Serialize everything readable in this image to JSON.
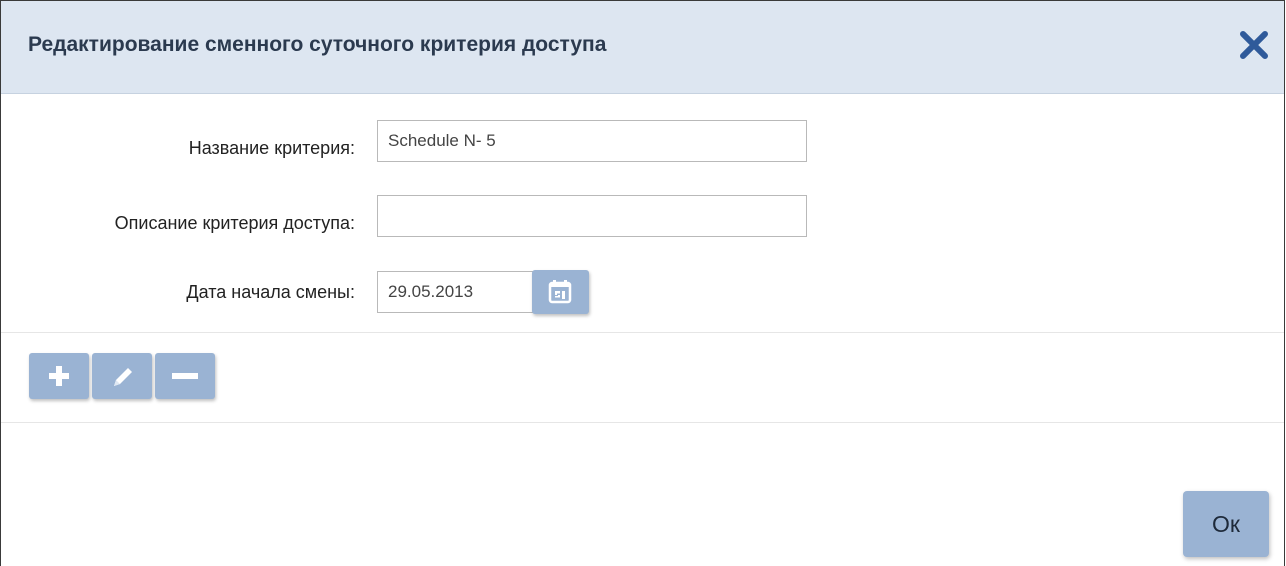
{
  "dialog": {
    "title": "Редактирование сменного суточного критерия доступа",
    "close_icon": "close-icon"
  },
  "form": {
    "name_label": "Название критерия:",
    "name_value": "Schedule N- 5",
    "description_label": "Описание критерия доступа:",
    "description_value": "",
    "start_date_label": "Дата начала смены:",
    "start_date_value": "29.05.2013",
    "calendar_icon": "calendar-icon"
  },
  "toolbar": {
    "add_icon": "plus-icon",
    "edit_icon": "pencil-icon",
    "remove_icon": "minus-icon"
  },
  "footer": {
    "ok_label": "Ок"
  },
  "colors": {
    "header_bg": "#dde6f1",
    "title_text": "#2b3a4f",
    "close_icon": "#2f5a9a",
    "button_bg": "#9ab3d3"
  }
}
